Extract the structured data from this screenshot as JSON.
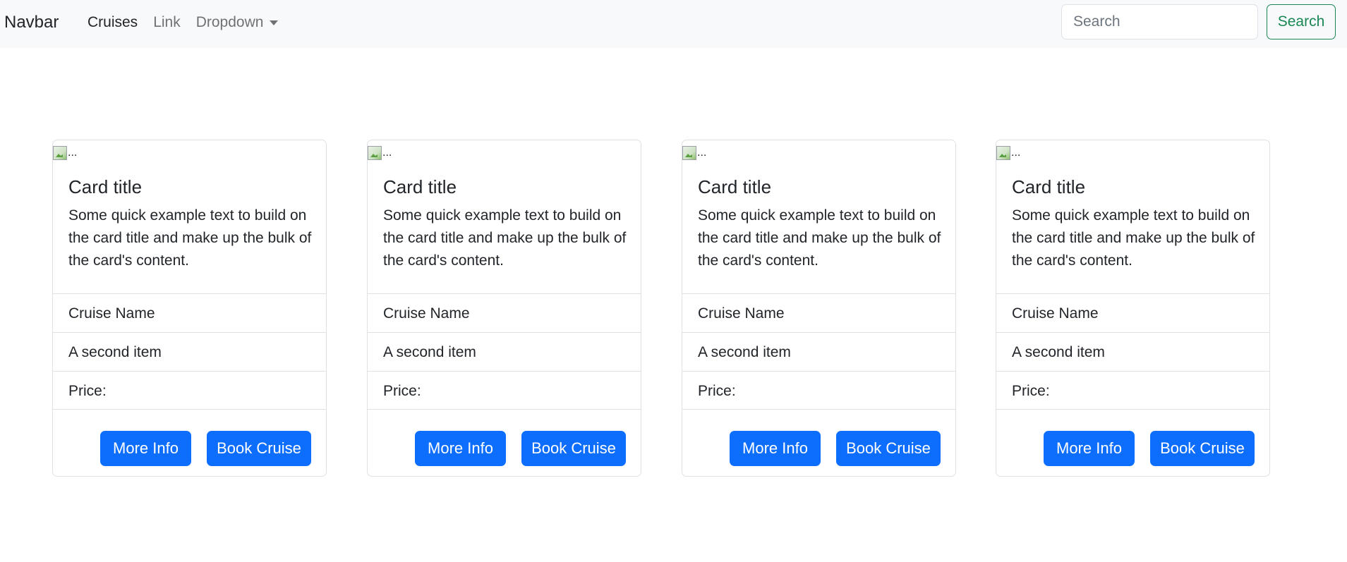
{
  "navbar": {
    "brand": "Navbar",
    "links": [
      {
        "label": "Cruises",
        "active": true
      },
      {
        "label": "Link",
        "active": false
      },
      {
        "label": "Dropdown",
        "active": false
      }
    ],
    "search": {
      "placeholder": "Search",
      "value": "",
      "button_label": "Search"
    }
  },
  "cards": [
    {
      "image_alt": "...",
      "title": "Card title",
      "text": "Some quick example text to build on the card title and make up the bulk of the card's content.",
      "items": [
        "Cruise Name",
        "A second item",
        "Price:"
      ],
      "more_info_label": "More Info",
      "book_label": "Book Cruise"
    },
    {
      "image_alt": "...",
      "title": "Card title",
      "text": "Some quick example text to build on the card title and make up the bulk of the card's content.",
      "items": [
        "Cruise Name",
        "A second item",
        "Price:"
      ],
      "more_info_label": "More Info",
      "book_label": "Book Cruise"
    },
    {
      "image_alt": "...",
      "title": "Card title",
      "text": "Some quick example text to build on the card title and make up the bulk of the card's content.",
      "items": [
        "Cruise Name",
        "A second item",
        "Price:"
      ],
      "more_info_label": "More Info",
      "book_label": "Book Cruise"
    },
    {
      "image_alt": "...",
      "title": "Card title",
      "text": "Some quick example text to build on the card title and make up the bulk of the card's content.",
      "items": [
        "Cruise Name",
        "A second item",
        "Price:"
      ],
      "more_info_label": "More Info",
      "book_label": "Book Cruise"
    }
  ],
  "colors": {
    "primary": "#0d6efd",
    "success": "#198754",
    "navbar_bg": "#f8f9fa"
  },
  "icons": {
    "card_image": "broken-image-icon",
    "dropdown": "caret-down-icon"
  }
}
